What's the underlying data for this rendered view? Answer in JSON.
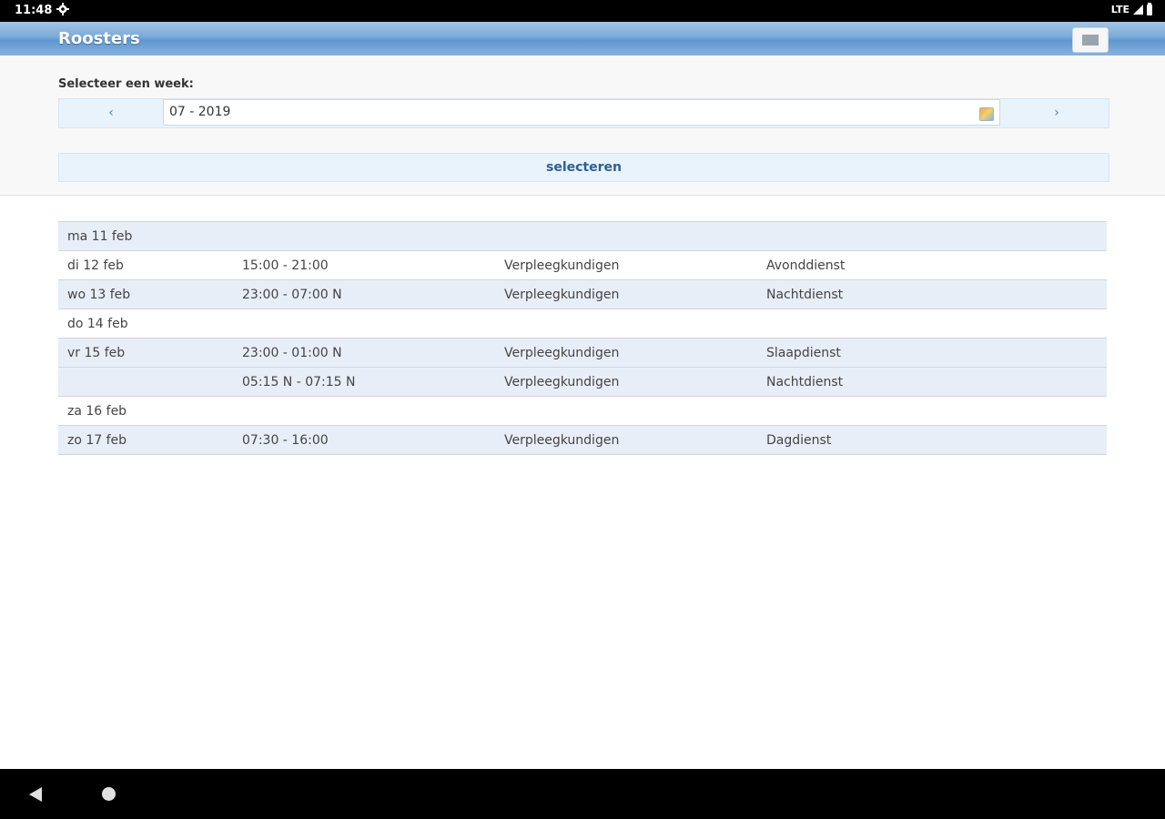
{
  "status_bar": {
    "time": "11:48",
    "network": "LTE"
  },
  "app_bar": {
    "title": "Roosters"
  },
  "week_selector": {
    "label": "Selecteer een week:",
    "prev": "‹",
    "next": "›",
    "value": "07 - 2019",
    "select_label": "selecteren"
  },
  "schedule": {
    "rows": [
      {
        "day": "ma 11 feb",
        "time": "",
        "department": "",
        "shift": ""
      },
      {
        "day": "di 12 feb",
        "time": "15:00 - 21:00",
        "department": "Verpleegkundigen",
        "shift": "Avonddienst"
      },
      {
        "day": "wo 13 feb",
        "time": "23:00 - 07:00 N",
        "department": "Verpleegkundigen",
        "shift": "Nachtdienst"
      },
      {
        "day": "do 14 feb",
        "time": "",
        "department": "",
        "shift": ""
      },
      {
        "day": "vr 15 feb",
        "time": "23:00 - 01:00 N",
        "department": "Verpleegkundigen",
        "shift": "Slaapdienst"
      },
      {
        "day": "",
        "time": "05:15 N - 07:15 N",
        "department": "Verpleegkundigen",
        "shift": "Nachtdienst"
      },
      {
        "day": "za 16 feb",
        "time": "",
        "department": "",
        "shift": ""
      },
      {
        "day": "zo 17 feb",
        "time": "07:30 - 16:00",
        "department": "Verpleegkundigen",
        "shift": "Dagdienst"
      }
    ]
  }
}
